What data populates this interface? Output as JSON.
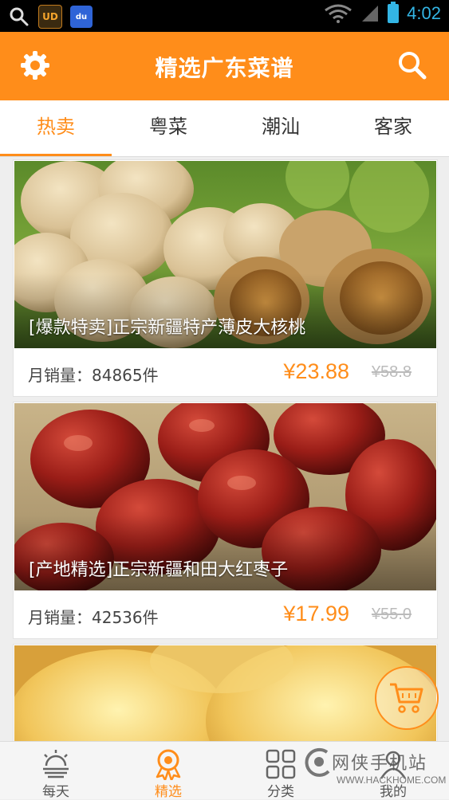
{
  "status_bar": {
    "time": "4:02",
    "ud_icon_label": "UD",
    "du_icon_label": "du"
  },
  "app_bar": {
    "title": "精选广东菜谱"
  },
  "tabs": [
    {
      "label": "热卖",
      "active": true
    },
    {
      "label": "粤菜",
      "active": false
    },
    {
      "label": "潮汕",
      "active": false
    },
    {
      "label": "客家",
      "active": false
    }
  ],
  "products": [
    {
      "title": "[爆款特卖]正宗新疆特产薄皮大核桃",
      "sales": "月销量：84865件",
      "price": "¥23.88",
      "old_price": "¥58.8",
      "image": "walnuts"
    },
    {
      "title": "[产地精选]正宗新疆和田大红枣子",
      "sales": "月销量：42536件",
      "price": "¥17.99",
      "old_price": "¥55.0",
      "image": "red-dates"
    },
    {
      "image": "white-fungus"
    }
  ],
  "bottom_nav": [
    {
      "label": "每天",
      "icon": "sunrise-icon",
      "active": false
    },
    {
      "label": "精选",
      "icon": "award-ribbon-icon",
      "active": true
    },
    {
      "label": "分类",
      "icon": "grid-icon",
      "active": false
    },
    {
      "label": "我的",
      "icon": "user-icon",
      "active": false
    }
  ],
  "watermark": {
    "text": "网侠手机站",
    "url": "WWW.HACKHOME.COM"
  },
  "colors": {
    "accent": "#ff8d1a",
    "price": "#ff8d1a",
    "status_time": "#33b5e5"
  }
}
